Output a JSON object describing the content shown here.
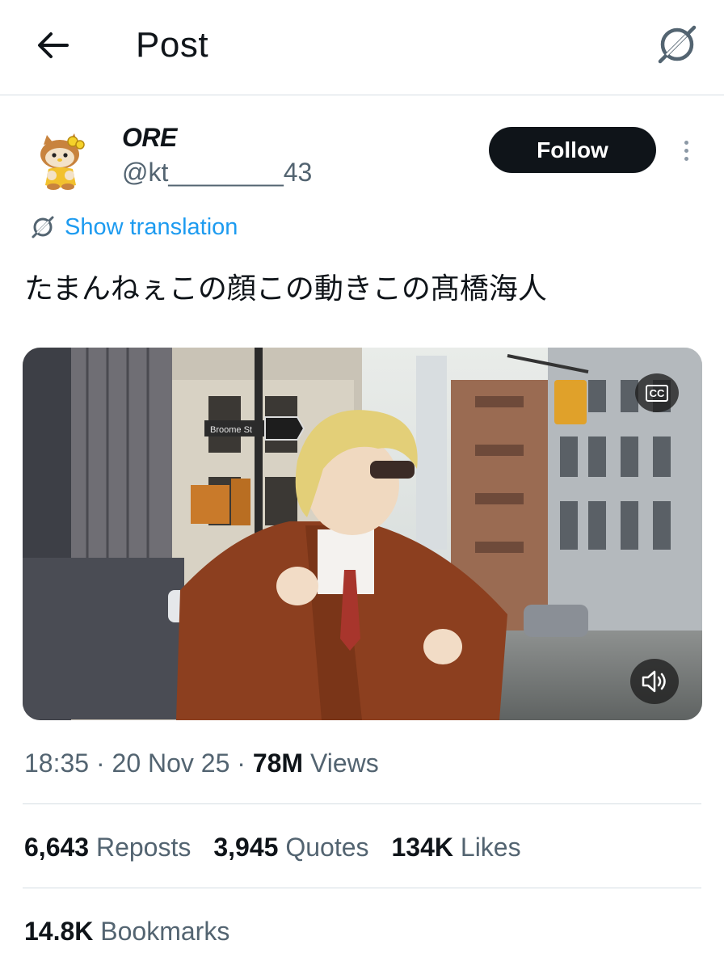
{
  "header": {
    "title": "Post"
  },
  "author": {
    "display_name": "ORE",
    "handle": "@kt________43"
  },
  "follow_label": "Follow",
  "translation_label": "Show translation",
  "post_text": "たまんねぇこの顔この動きこの髙橋海人",
  "media": {
    "cc_label": "CC",
    "sign_text": "Broome St"
  },
  "meta": {
    "time": "18:35",
    "separator1": " · ",
    "date": "20 Nov 25",
    "separator2": " · ",
    "views_count": "78M",
    "views_label": " Views"
  },
  "stats": {
    "reposts_count": "6,643",
    "reposts_label": " Reposts",
    "quotes_count": "3,945",
    "quotes_label": " Quotes",
    "likes_count": "134K",
    "likes_label": " Likes",
    "bookmarks_count": "14.8K",
    "bookmarks_label": " Bookmarks"
  },
  "icons": {
    "back": "back-arrow-icon",
    "grok": "grok-icon",
    "translate": "translate-icon",
    "more": "more-vertical-icon",
    "captions": "captions-icon",
    "volume": "volume-icon"
  },
  "colors": {
    "accent": "#1d9bf0",
    "text": "#0f1419",
    "secondary": "#536471",
    "button": "#0f1419"
  }
}
